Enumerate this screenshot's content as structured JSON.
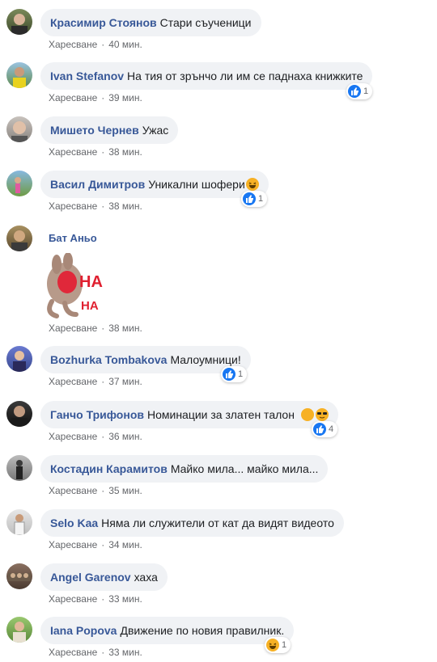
{
  "comments": [
    {
      "author": "Красимир Стоянов",
      "text": "Стари съученици",
      "like_label": "Харесване",
      "time": "40 мин."
    },
    {
      "author": "Ivan Stefanov",
      "text": "На тия от зрънчо ли им се паднаха книжките",
      "like_label": "Харесване",
      "time": "39 мин.",
      "reactions": "1"
    },
    {
      "author": "Мишето Чернев",
      "text": "Ужас",
      "like_label": "Харесване",
      "time": "38 мин."
    },
    {
      "author": "Васил Димитров",
      "text": "Уникални шофери",
      "like_label": "Харесване",
      "time": "38 мин.",
      "reactions": "1"
    },
    {
      "author": "Бат Аньо",
      "text": "",
      "like_label": "Харесване",
      "time": "38 мин.",
      "sticker_text1": "HA",
      "sticker_text2": "HA"
    },
    {
      "author": "Bozhurka Tombakova",
      "text": "Малоумници!",
      "like_label": "Харесване",
      "time": "37 мин.",
      "reactions": "1"
    },
    {
      "author": "Ганчо Трифонов",
      "text": "Номинации за златен талон",
      "like_label": "Харесване",
      "time": "36 мин.",
      "reactions": "4"
    },
    {
      "author": "Костадин Карамитов",
      "text": "Майко мила... майко мила...",
      "like_label": "Харесване",
      "time": "35 мин."
    },
    {
      "author": "Selo Kaa",
      "text": "Няма ли служители от кат да видят видеото",
      "like_label": "Харесване",
      "time": "34 мин."
    },
    {
      "author": "Angel Garenov",
      "text": "хаха",
      "like_label": "Харесване",
      "time": "33 мин."
    },
    {
      "author": "Iana Popova",
      "text": "Движение по новия правилник.",
      "like_label": "Харесване",
      "time": "33 мин.",
      "reactions": "1"
    }
  ],
  "colors": {
    "author": "#385898",
    "bubble": "#f0f2f5",
    "meta": "#65676b",
    "like": "#1877f2",
    "haha": "#f7b125"
  }
}
